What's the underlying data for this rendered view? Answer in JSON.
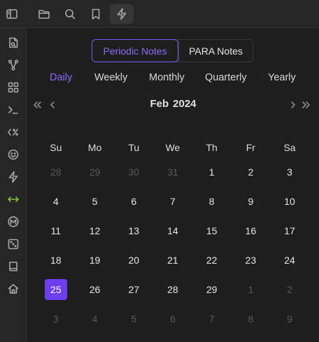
{
  "topbar": {
    "buttons": [
      {
        "name": "sidebar-toggle-icon",
        "icon": "sidebar"
      },
      {
        "name": "files-icon",
        "icon": "folder"
      },
      {
        "name": "search-icon",
        "icon": "search"
      },
      {
        "name": "bookmark-icon",
        "icon": "bookmark"
      },
      {
        "name": "lightning-icon",
        "icon": "lightning",
        "active": true
      }
    ]
  },
  "ribbon": {
    "icons": [
      "new-note-icon",
      "graph-icon",
      "blocks-icon",
      "terminal-icon",
      "template-icon",
      "smiley-icon",
      "lightning-icon",
      "arrows-horizontal-icon",
      "markdown-circle-icon",
      "dice-icon",
      "book-icon",
      "home-icon"
    ]
  },
  "switcher": {
    "options": [
      "Periodic Notes",
      "PARA Notes"
    ],
    "selected": "Periodic Notes"
  },
  "period_tabs": {
    "items": [
      "Daily",
      "Weekly",
      "Monthly",
      "Quarterly",
      "Yearly"
    ],
    "selected": "Daily"
  },
  "calendar": {
    "month": "Feb",
    "year": "2024",
    "weekdays": [
      "Su",
      "Mo",
      "Tu",
      "We",
      "Th",
      "Fr",
      "Sa"
    ],
    "weeks": [
      [
        {
          "d": "28",
          "m": true
        },
        {
          "d": "29",
          "m": true
        },
        {
          "d": "30",
          "m": true
        },
        {
          "d": "31",
          "m": true
        },
        {
          "d": "1"
        },
        {
          "d": "2"
        },
        {
          "d": "3"
        }
      ],
      [
        {
          "d": "4"
        },
        {
          "d": "5"
        },
        {
          "d": "6"
        },
        {
          "d": "7"
        },
        {
          "d": "8"
        },
        {
          "d": "9"
        },
        {
          "d": "10"
        }
      ],
      [
        {
          "d": "11"
        },
        {
          "d": "12"
        },
        {
          "d": "13"
        },
        {
          "d": "14"
        },
        {
          "d": "15"
        },
        {
          "d": "16"
        },
        {
          "d": "17"
        }
      ],
      [
        {
          "d": "18"
        },
        {
          "d": "19"
        },
        {
          "d": "20"
        },
        {
          "d": "21"
        },
        {
          "d": "22"
        },
        {
          "d": "23"
        },
        {
          "d": "24"
        }
      ],
      [
        {
          "d": "25",
          "today": true
        },
        {
          "d": "26"
        },
        {
          "d": "27"
        },
        {
          "d": "28"
        },
        {
          "d": "29"
        },
        {
          "d": "1",
          "m": true
        },
        {
          "d": "2",
          "m": true
        }
      ],
      [
        {
          "d": "3",
          "m": true
        },
        {
          "d": "4",
          "m": true
        },
        {
          "d": "5",
          "m": true
        },
        {
          "d": "6",
          "m": true
        },
        {
          "d": "7",
          "m": true
        },
        {
          "d": "8",
          "m": true
        },
        {
          "d": "9",
          "m": true
        }
      ]
    ]
  },
  "colors": {
    "accent": "#7a5af5",
    "today_bg": "#6d3ff0",
    "muted_day": "#5a5a5a",
    "background": "#1e1e1e"
  }
}
